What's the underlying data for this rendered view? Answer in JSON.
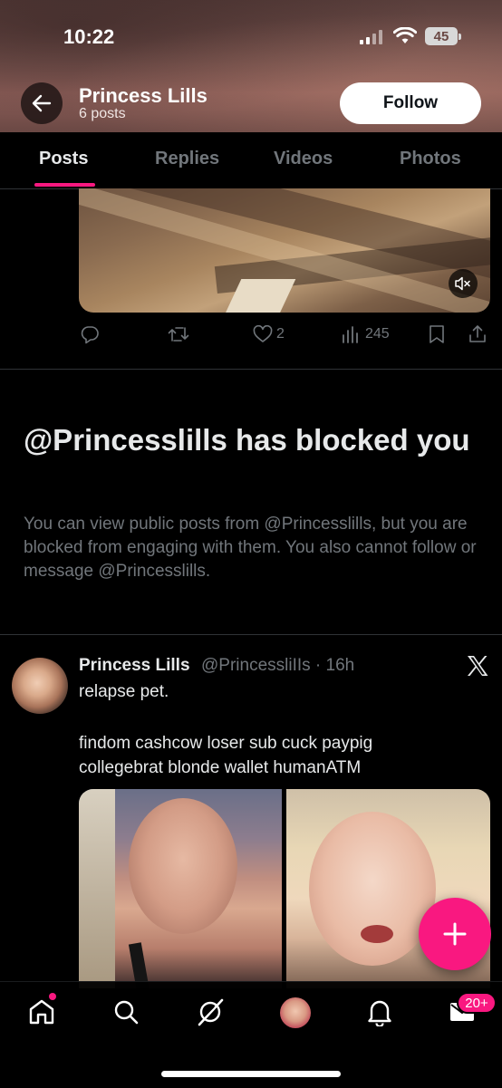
{
  "status_bar": {
    "time": "10:22",
    "battery": "45"
  },
  "header": {
    "name": "Princess Lills",
    "posts_count": "6 posts",
    "follow_label": "Follow"
  },
  "tabs": [
    {
      "label": "Posts",
      "active": true
    },
    {
      "label": "Replies"
    },
    {
      "label": "Videos"
    },
    {
      "label": "Photos"
    }
  ],
  "video_post": {
    "likes": "2",
    "views": "245"
  },
  "blocked": {
    "title": "@Princesslills has blocked you",
    "description": "You can view public posts from @Princesslills, but you are blocked from engaging with them. You also cannot follow or message @Princesslills."
  },
  "tweet": {
    "name": "Princess Lills",
    "handle_time": "@PrincessliIIs · 16h",
    "line1": "relapse pet.",
    "line2": "findom cashcow loser sub cuck paypig collegebrat blonde wallet humanATM"
  },
  "bottom_nav": {
    "messages_badge": "20+"
  },
  "colors": {
    "accent": "#f91880",
    "muted": "#71767b",
    "text": "#e7e9ea",
    "background": "#000000"
  }
}
